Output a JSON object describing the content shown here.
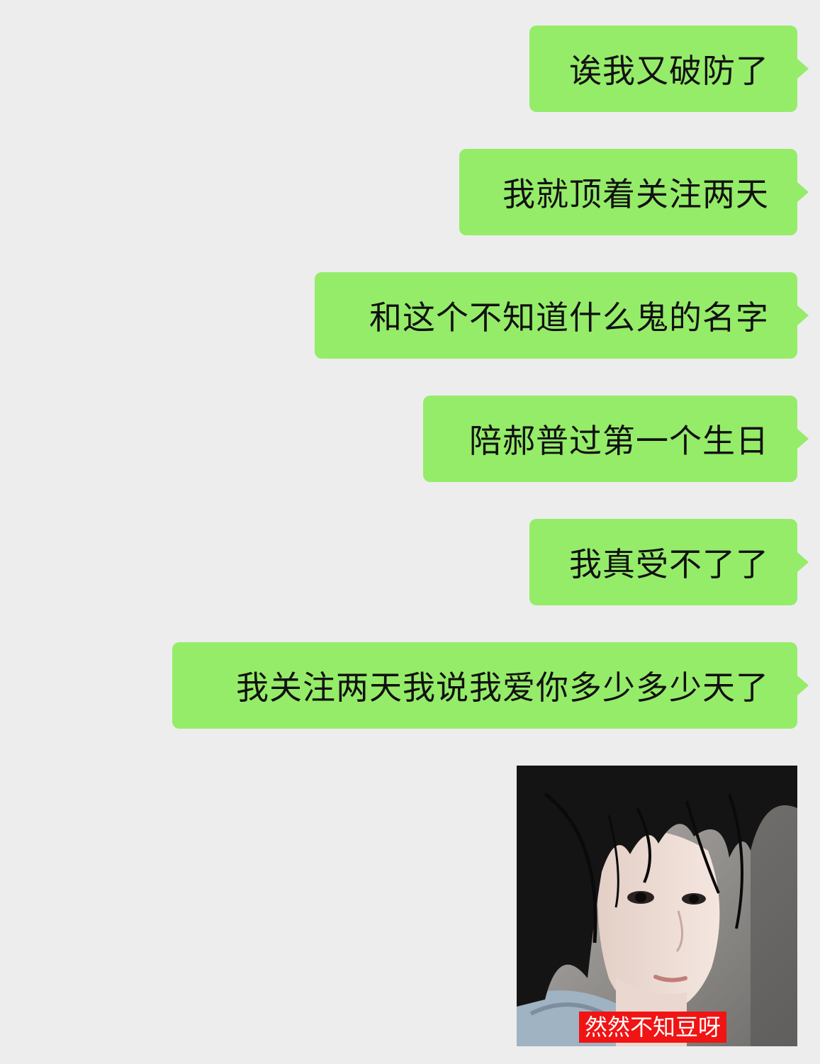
{
  "chat": {
    "messages": [
      {
        "text": "诶我又破防了"
      },
      {
        "text": "我就顶着关注两天"
      },
      {
        "text": "和这个不知道什么鬼的名字"
      },
      {
        "text": "陪郝普过第一个生日"
      },
      {
        "text": "我真受不了了"
      },
      {
        "text": "我关注两天我说我爱你多少多少天了"
      }
    ],
    "image": {
      "caption": "然然不知豆呀"
    }
  },
  "colors": {
    "background": "#ededed",
    "bubble_green": "#95ec69",
    "caption_red": "#f01414"
  }
}
